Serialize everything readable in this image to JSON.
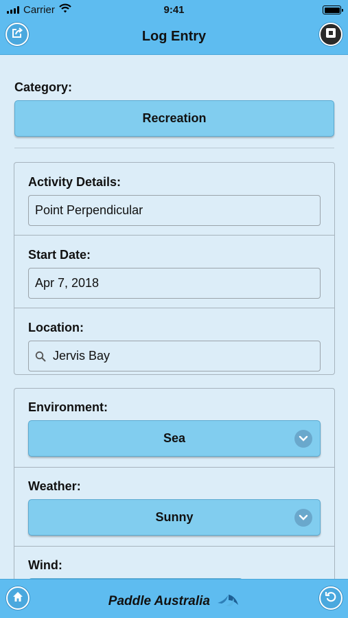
{
  "status_bar": {
    "carrier": "Carrier",
    "time": "9:41"
  },
  "nav": {
    "title": "Log Entry",
    "left_icon": "share-icon",
    "right_icon": "stop-icon"
  },
  "category": {
    "label": "Category:",
    "value": "Recreation"
  },
  "details": {
    "activity_label": "Activity Details:",
    "activity_value": "Point Perpendicular",
    "start_date_label": "Start Date:",
    "start_date_value": "Apr 7, 2018",
    "location_label": "Location:",
    "location_value": "Jervis Bay"
  },
  "conditions": {
    "environment_label": "Environment:",
    "environment_value": "Sea",
    "weather_label": "Weather:",
    "weather_value": "Sunny",
    "wind_label": "Wind:"
  },
  "footer": {
    "brand": "Paddle Australia",
    "left_icon": "home-icon",
    "right_icon": "undo-icon"
  },
  "colors": {
    "header": "#5ebcf0",
    "button": "#81cdef",
    "background": "#dcedf8"
  }
}
